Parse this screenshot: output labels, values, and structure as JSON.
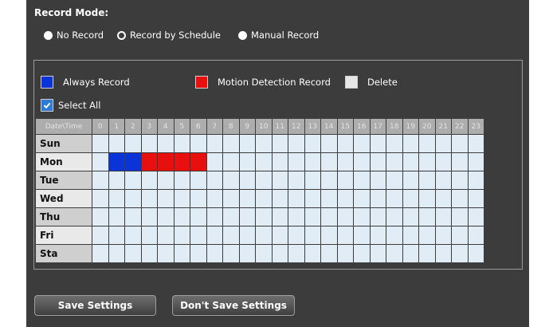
{
  "record_mode": {
    "title": "Record Mode:",
    "options": [
      {
        "label": "No Record",
        "selected": false
      },
      {
        "label": "Record by Schedule",
        "selected": true
      },
      {
        "label": "Manual Record",
        "selected": false
      }
    ]
  },
  "legend": {
    "always_label": "Always Record",
    "always_color": "#0a33d8",
    "motion_label": "Motion Detection Record",
    "motion_color": "#e80f0f",
    "delete_label": "Delete",
    "delete_color": "#e6e6e6",
    "select_all_label": "Select All",
    "select_all_icon": "check-icon"
  },
  "schedule": {
    "header_label": "Date\\Time",
    "hours": [
      "0",
      "1",
      "2",
      "3",
      "4",
      "5",
      "6",
      "7",
      "8",
      "9",
      "10",
      "11",
      "12",
      "13",
      "14",
      "15",
      "16",
      "17",
      "18",
      "19",
      "20",
      "21",
      "22",
      "23"
    ],
    "days": [
      "Sun",
      "Mon",
      "Tue",
      "Wed",
      "Thu",
      "Fri",
      "Sta"
    ],
    "entries": [
      {
        "day": "Mon",
        "hour": 1,
        "mode": "always"
      },
      {
        "day": "Mon",
        "hour": 2,
        "mode": "always"
      },
      {
        "day": "Mon",
        "hour": 3,
        "mode": "motion"
      },
      {
        "day": "Mon",
        "hour": 4,
        "mode": "motion"
      },
      {
        "day": "Mon",
        "hour": 5,
        "mode": "motion"
      },
      {
        "day": "Mon",
        "hour": 6,
        "mode": "motion"
      }
    ]
  },
  "buttons": {
    "save": "Save Settings",
    "dont_save": "Don't Save Settings"
  }
}
